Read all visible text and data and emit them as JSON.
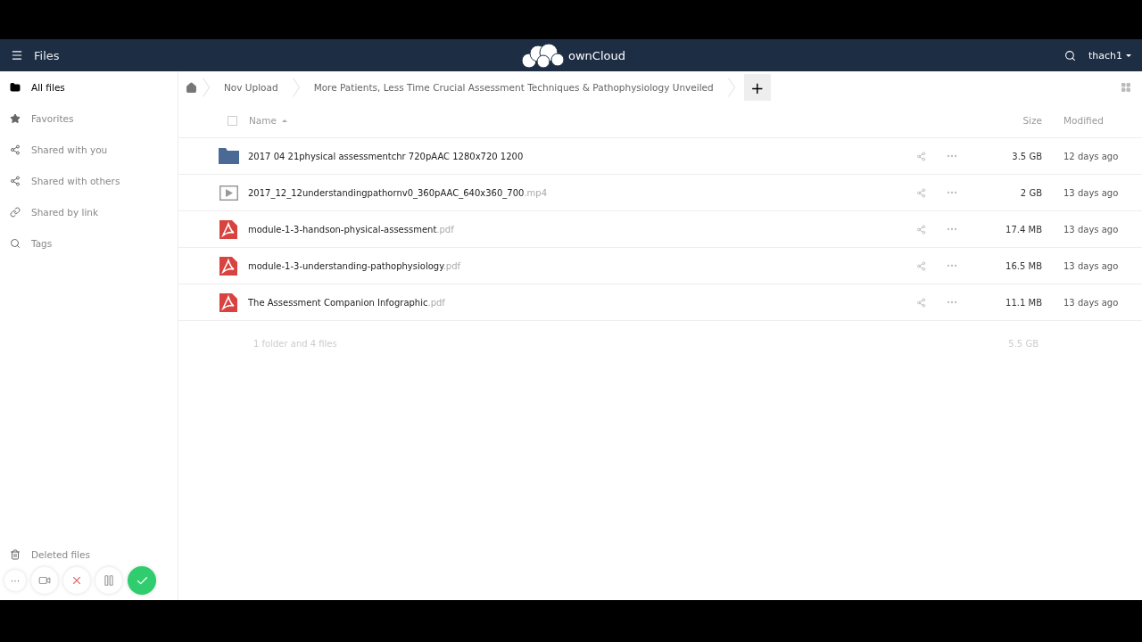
{
  "header": {
    "app_title": "Files",
    "brand": "ownCloud",
    "user": "thach1"
  },
  "sidebar": {
    "items": [
      {
        "kind": "folder",
        "label": "All files",
        "selected": true
      },
      {
        "kind": "star",
        "label": "Favorites",
        "selected": false
      },
      {
        "kind": "share",
        "label": "Shared with you",
        "selected": false
      },
      {
        "kind": "share",
        "label": "Shared with others",
        "selected": false
      },
      {
        "kind": "link",
        "label": "Shared by link",
        "selected": false
      },
      {
        "kind": "tag",
        "label": "Tags",
        "selected": false
      }
    ],
    "bottom_items": [
      {
        "kind": "trash",
        "label": "Deleted files"
      }
    ]
  },
  "breadcrumbs": [
    "Nov Upload",
    "More Patients, Less Time Crucial Assessment Techniques & Pathophysiology Unveiled"
  ],
  "new_button": "+",
  "table": {
    "columns": {
      "name": "Name",
      "size": "Size",
      "modified": "Modified"
    },
    "select_all_checked": false,
    "rows": [
      {
        "kind": "folder",
        "name": "2017 04 21physical assessmentchr 720pAAC 1280x720 1200",
        "size": "3.5 GB",
        "modified": "12 days ago"
      },
      {
        "kind": "video",
        "name": "2017_12_12understandingpathornv0_360pAAC_640x360_700",
        "extension": ".mp4",
        "size": "2 GB",
        "modified": "13 days ago"
      },
      {
        "kind": "pdf",
        "name": "module-1-3-handson-physical-assessment",
        "extension": ".pdf",
        "size": "17.4 MB",
        "modified": "13 days ago"
      },
      {
        "kind": "pdf",
        "name": "module-1-3-understanding-pathophysiology",
        "extension": ".pdf",
        "size": "16.5 MB",
        "modified": "13 days ago"
      },
      {
        "kind": "pdf",
        "name": "The Assessment Companion Infographic",
        "extension": ".pdf",
        "size": "11.1 MB",
        "modified": "13 days ago"
      }
    ],
    "summary": {
      "count": "1 folder and 4 files",
      "size": "5.5 GB"
    }
  },
  "recorder": {
    "more": "···",
    "buttons": [
      {
        "kind": "camera"
      },
      {
        "kind": "cancel"
      },
      {
        "kind": "pause"
      },
      {
        "kind": "done"
      }
    ]
  }
}
